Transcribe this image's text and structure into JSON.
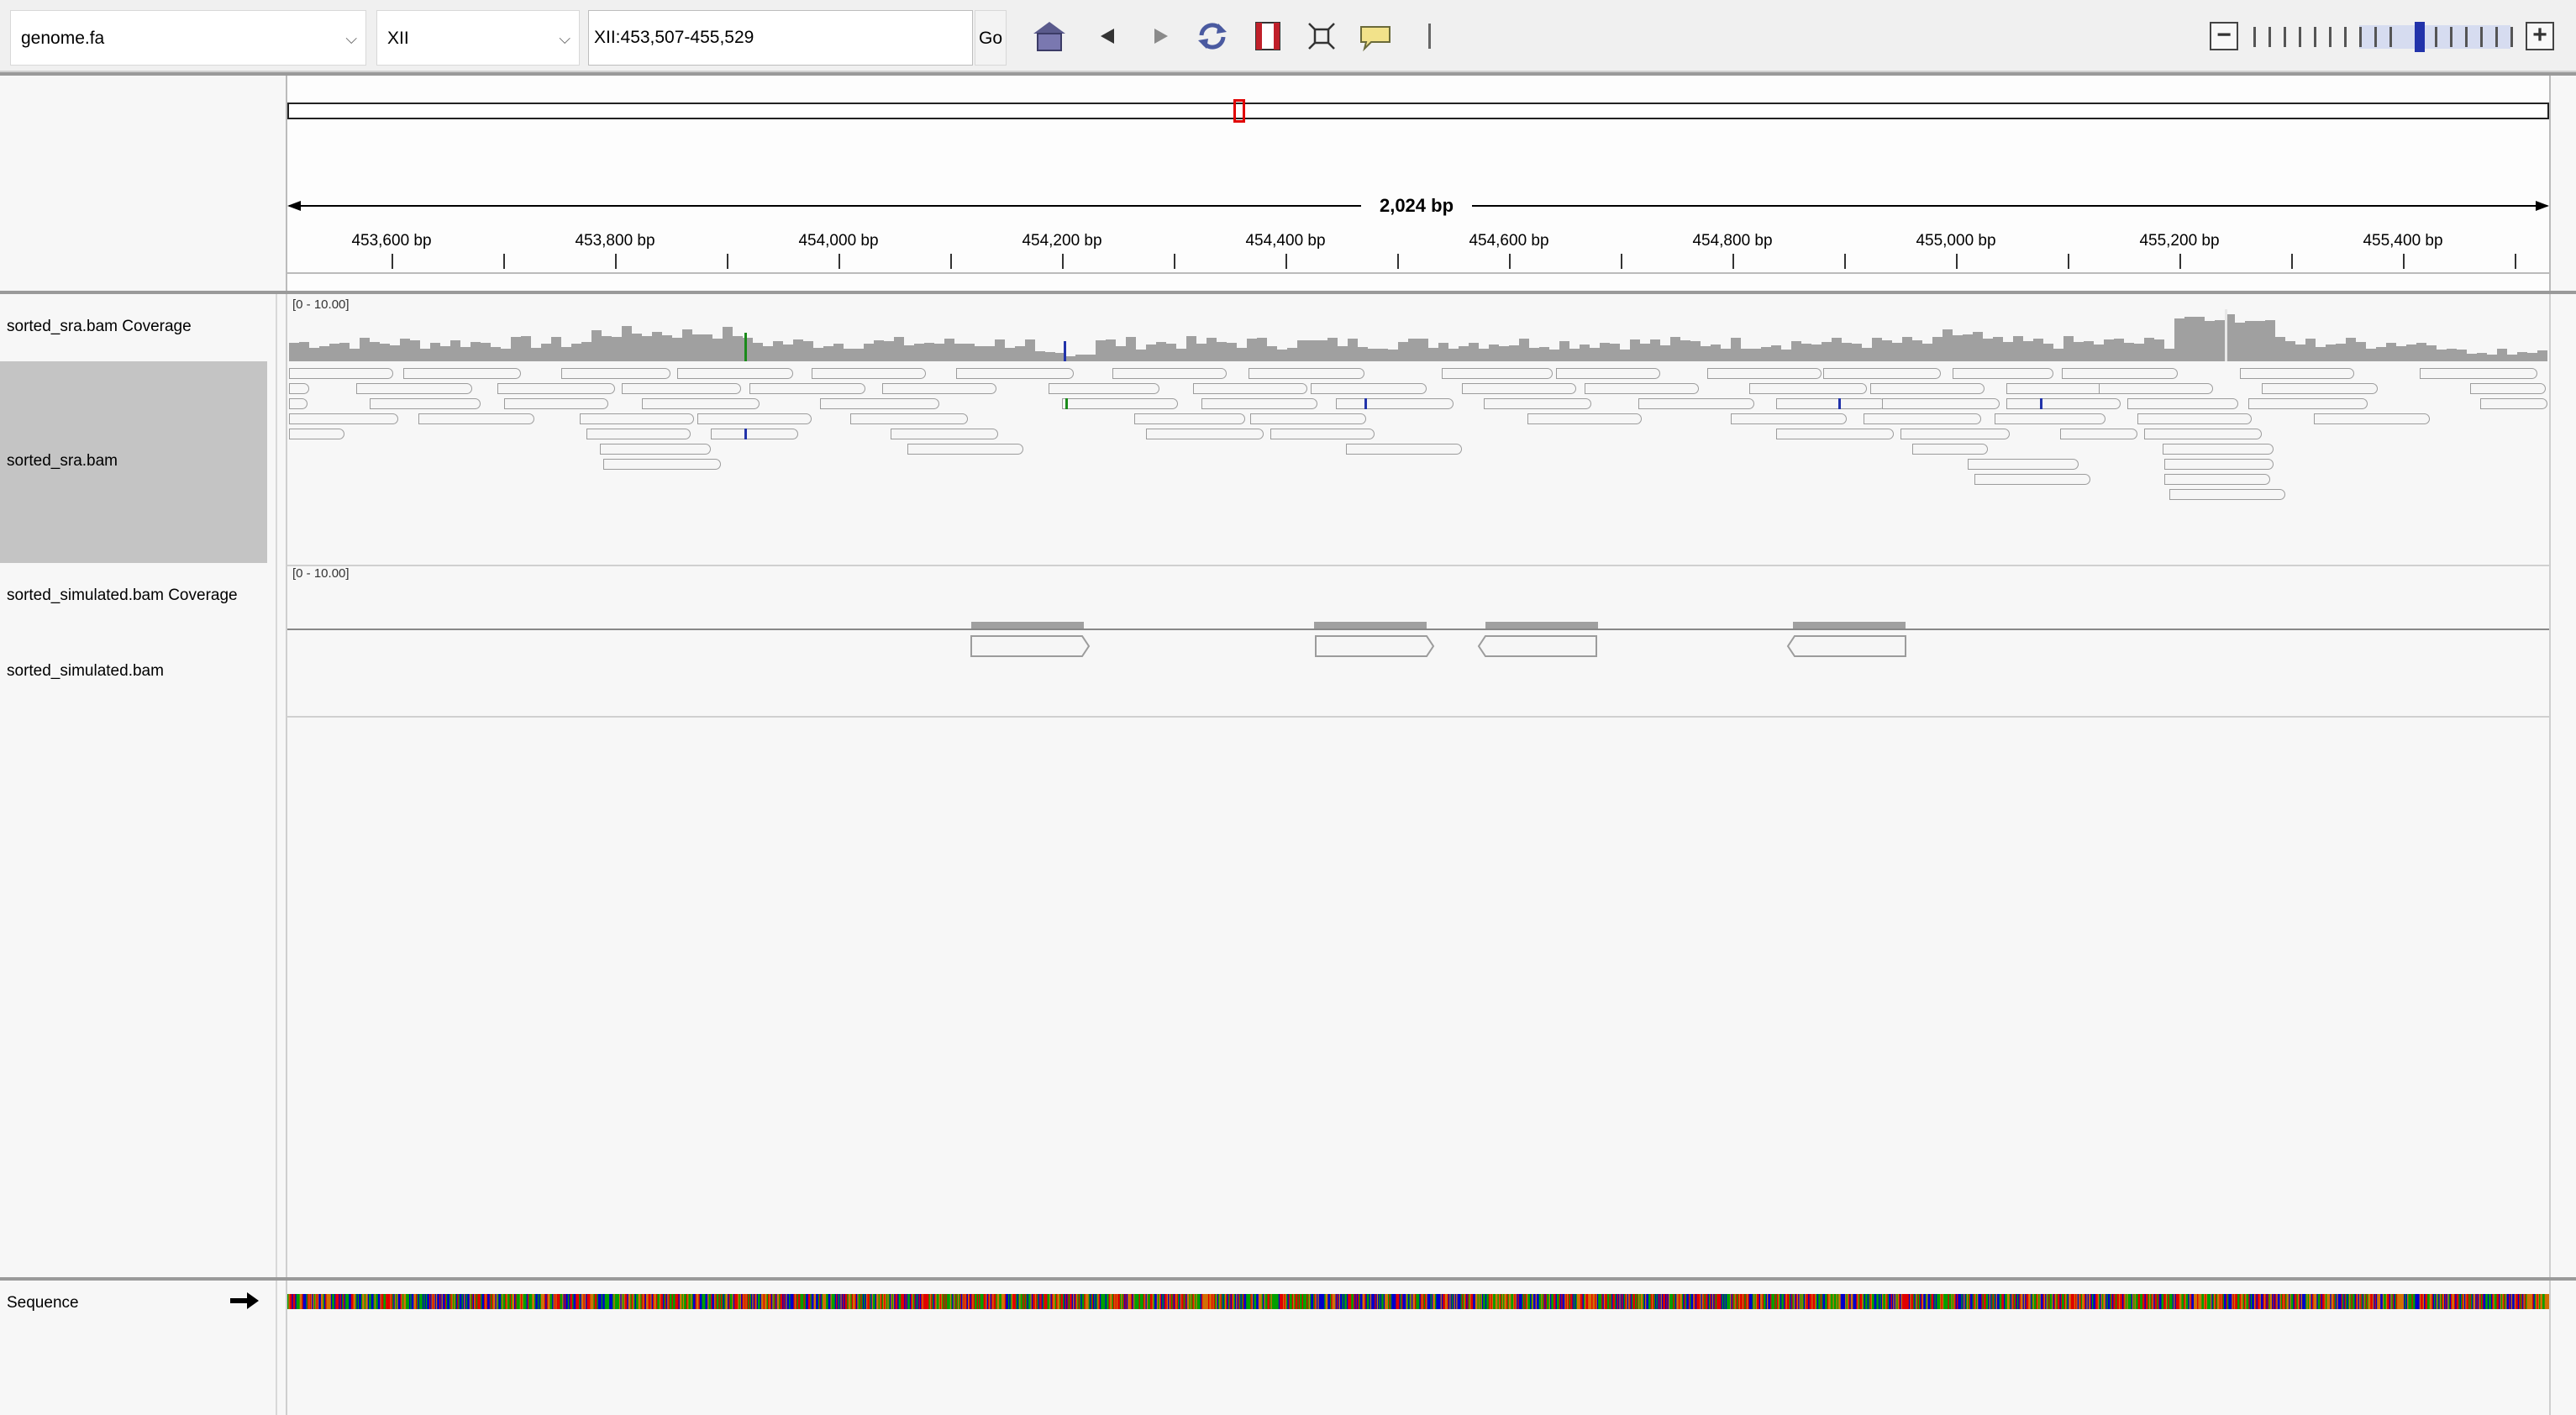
{
  "toolbar": {
    "genome": "genome.fa",
    "chromosome": "XII",
    "locus": "XII:453,507-455,529",
    "go_label": "Go",
    "icons": [
      "home-icon",
      "back-icon",
      "forward-icon",
      "refresh-icon",
      "roi-icon",
      "fit-window-icon",
      "popup-info-icon",
      "divider-icon"
    ]
  },
  "ruler": {
    "span_label": "2,024 bp",
    "tick_labels": [
      "453,600 bp",
      "453,800 bp",
      "454,000 bp",
      "454,200 bp",
      "454,400 bp",
      "454,600 bp",
      "454,800 bp",
      "455,000 bp",
      "455,200 bp",
      "455,400 bp"
    ]
  },
  "tracks": {
    "sra_coverage": {
      "name": "sorted_sra.bam Coverage",
      "scale": "[0 - 10.00]"
    },
    "sra_alignments": {
      "name": "sorted_sra.bam"
    },
    "sim_coverage": {
      "name": "sorted_simulated.bam Coverage",
      "scale": "[0 - 10.00]"
    },
    "sim_alignments": {
      "name": "sorted_simulated.bam"
    },
    "sequence": {
      "name": "Sequence"
    }
  },
  "colors": {
    "coverage": "#a0a0a0",
    "roi_marker": "#e00000",
    "base_A": "#00a000",
    "base_C": "#0000cc",
    "base_G": "#d17105",
    "base_T": "#e00000"
  }
}
